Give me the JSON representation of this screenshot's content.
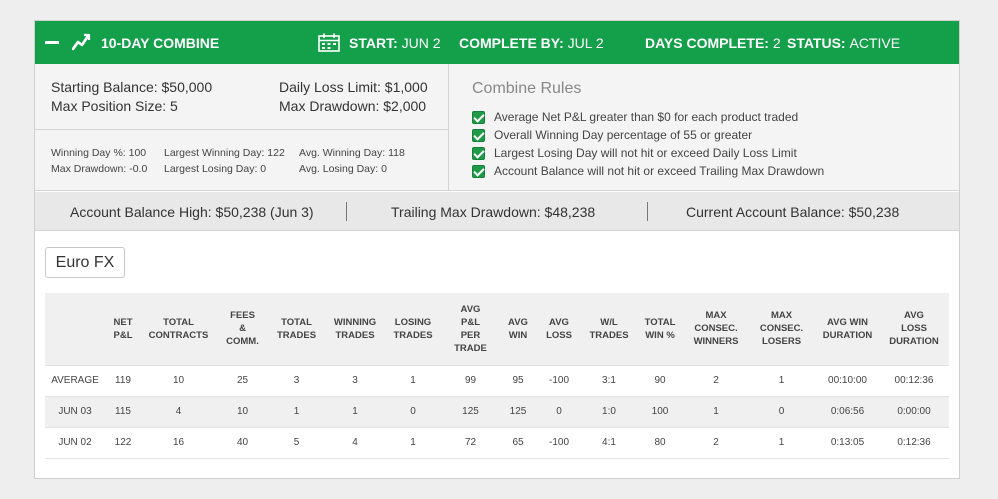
{
  "header": {
    "collapse_icon": "minus-icon",
    "trend_icon": "trend-line-icon",
    "calendar_icon": "calendar-icon",
    "title": "10-DAY COMBINE",
    "start_label": "START:",
    "start_value": "JUN 2",
    "complete_label": "COMPLETE BY:",
    "complete_value": "JUL 2",
    "days_label": "DAYS COMPLETE:",
    "days_value": "2",
    "status_label": "STATUS:",
    "status_value": "ACTIVE"
  },
  "summary": {
    "starting_balance": "Starting Balance: $50,000",
    "max_position_size": "Max Position Size: 5",
    "daily_loss_limit": "Daily Loss Limit: $1,000",
    "max_drawdown": "Max Drawdown: $2,000",
    "winning_day_pct": "Winning Day %: 100",
    "max_drawdown_small": "Max Drawdown: -0.0",
    "largest_winning_day": "Largest Winning Day: 122",
    "largest_losing_day": "Largest Losing Day: 0",
    "avg_winning_day": "Avg. Winning Day: 118",
    "avg_losing_day": "Avg. Losing Day: 0"
  },
  "rules": {
    "title": "Combine Rules",
    "items": [
      "Average Net P&L greater than $0 for each product traded",
      "Overall Winning Day percentage of 55 or greater",
      "Largest Losing Day will not hit or exceed Daily Loss Limit",
      "Account Balance will not hit or exceed Trailing Max Drawdown"
    ],
    "check_icon": "checkbox-checked-icon"
  },
  "balances": {
    "high": "Account Balance High: $50,238 (Jun 3)",
    "trailing": "Trailing Max Drawdown: $48,238",
    "current": "Current Account Balance: $50,238"
  },
  "product_tab": "Euro FX",
  "table": {
    "headers": [
      [
        ""
      ],
      [
        "NET",
        "P&L"
      ],
      [
        "TOTAL",
        "CONTRACTS"
      ],
      [
        "FEES",
        "&",
        "COMM."
      ],
      [
        "TOTAL",
        "TRADES"
      ],
      [
        "WINNING",
        "TRADES"
      ],
      [
        "LOSING",
        "TRADES"
      ],
      [
        "AVG",
        "P&L",
        "PER",
        "TRADE"
      ],
      [
        "AVG",
        "WIN"
      ],
      [
        "AVG",
        "LOSS"
      ],
      [
        "W/L",
        "TRADES"
      ],
      [
        "TOTAL",
        "WIN %"
      ],
      [
        "MAX",
        "CONSEC.",
        "WINNERS"
      ],
      [
        "MAX",
        "CONSEC.",
        "LOSERS"
      ],
      [
        "AVG WIN",
        "DURATION"
      ],
      [
        "AVG",
        "LOSS",
        "DURATION"
      ]
    ],
    "rows": [
      [
        "AVERAGE",
        "119",
        "10",
        "25",
        "3",
        "3",
        "1",
        "99",
        "95",
        "-100",
        "3:1",
        "90",
        "2",
        "1",
        "00:10:00",
        "00:12:36"
      ],
      [
        "JUN 03",
        "115",
        "4",
        "10",
        "1",
        "1",
        "0",
        "125",
        "125",
        "0",
        "1:0",
        "100",
        "1",
        "0",
        "0:06:56",
        "0:00:00"
      ],
      [
        "JUN 02",
        "122",
        "16",
        "40",
        "5",
        "4",
        "1",
        "72",
        "65",
        "-100",
        "4:1",
        "80",
        "2",
        "1",
        "0:13:05",
        "0:12:36"
      ]
    ]
  },
  "colors": {
    "header_green": "#149f4a",
    "check_green": "#1f9a47"
  }
}
